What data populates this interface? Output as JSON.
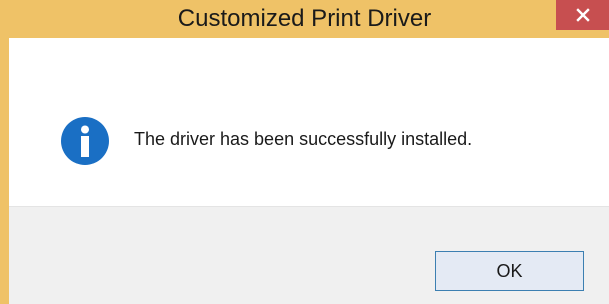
{
  "window": {
    "title": "Customized Print Driver",
    "frame_color": "#efc267",
    "close_button_color": "#c74f50",
    "close_icon": "close-icon"
  },
  "dialog": {
    "icon": "info-icon",
    "icon_color": "#1a6fc4",
    "message": "The driver has been successfully installed."
  },
  "buttons": {
    "ok_label": "OK"
  }
}
